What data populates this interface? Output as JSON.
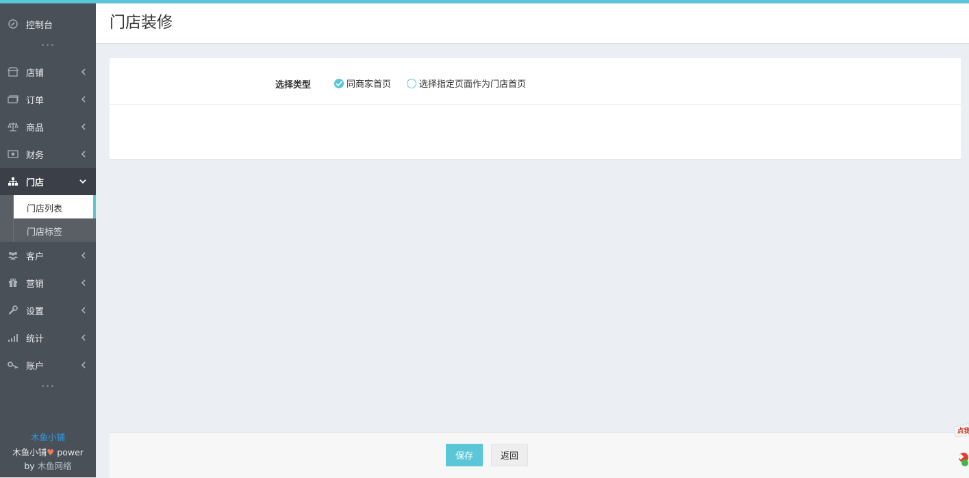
{
  "colors": {
    "accent": "#5bc6d8",
    "sidebar_bg": "#4a5058",
    "sidebar_active_bg": "#3b4048",
    "brand_blue": "#2f9be0",
    "heart": "#f0795a"
  },
  "sidebar": {
    "dashboard": {
      "label": "控制台",
      "icon": "dashboard-icon"
    },
    "items": [
      {
        "label": "店铺",
        "icon": "store-icon"
      },
      {
        "label": "订单",
        "icon": "order-icon"
      },
      {
        "label": "商品",
        "icon": "scale-icon"
      },
      {
        "label": "财务",
        "icon": "money-icon"
      },
      {
        "label": "门店",
        "icon": "sitemap-icon"
      },
      {
        "label": "客户",
        "icon": "users-icon"
      },
      {
        "label": "营销",
        "icon": "gift-icon"
      },
      {
        "label": "设置",
        "icon": "wrench-icon"
      },
      {
        "label": "统计",
        "icon": "signal-icon"
      },
      {
        "label": "账户",
        "icon": "key-icon"
      }
    ],
    "subitems": [
      {
        "label": "门店列表"
      },
      {
        "label": "门店标签"
      }
    ],
    "brand": {
      "name": "木鱼小铺",
      "line2_prefix": "木鱼小铺",
      "line2_suffix": " power",
      "line3_prefix": "by ",
      "line3_company": "木鱼网络"
    }
  },
  "header": {
    "title": "门店装修"
  },
  "form": {
    "type_label": "选择类型",
    "options": [
      {
        "label": "同商家首页",
        "checked": true
      },
      {
        "label": "选择指定页面作为门店首页",
        "checked": false
      }
    ]
  },
  "footer": {
    "save_label": "保存",
    "back_label": "返回"
  },
  "widget": {
    "text": "点我"
  }
}
